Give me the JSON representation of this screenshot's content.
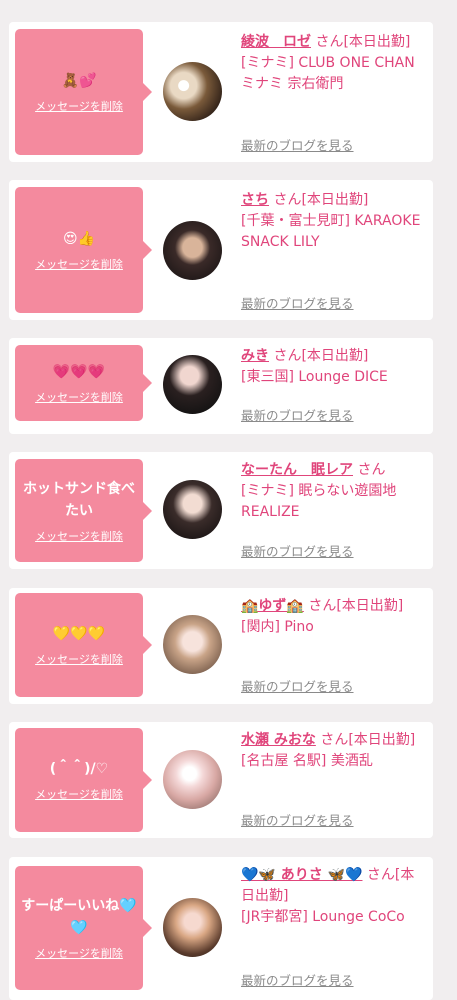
{
  "colors": {
    "accent": "#e0457b",
    "bubble": "#f48a9e",
    "background": "#f1eeef"
  },
  "delete_label": "メッセージを削除",
  "blog_label": "最新のブログを見る",
  "items": [
    {
      "message": "🧸💕",
      "name": "綾波　ロゼ",
      "suffix": " さん[本日出勤]",
      "shop": "[ミナミ] CLUB ONE CHAN ミナミ 宗右衛門"
    },
    {
      "message": "😍👍",
      "name": "さち",
      "suffix": " さん[本日出勤]",
      "shop": "[千葉・富士見町] KARAOKE SNACK LILY"
    },
    {
      "message": "💗💗💗",
      "name": "みき",
      "suffix": " さん[本日出勤]",
      "shop": "[東三国] Lounge DICE"
    },
    {
      "message": "ホットサンド食べたい",
      "name": "なーたん　眠レア",
      "suffix": " さん",
      "shop": "[ミナミ] 眠らない遊園地REALIZE"
    },
    {
      "message": "💛💛💛",
      "name": "🏫ゆず🏫",
      "suffix": " さん[本日出勤]",
      "shop": "[関内] Pino"
    },
    {
      "message": "(＾＾)/♡",
      "name": "水瀬 みおな",
      "suffix": " さん[本日出勤]",
      "shop": "[名古屋 名駅] 美酒乱"
    },
    {
      "message": "すーぱーいいね🩵🩵",
      "name": "💙🦋 ありさ 🦋💙",
      "suffix": " さん[本日出勤]",
      "shop": "[JR宇都宮] Lounge CoCo"
    }
  ]
}
